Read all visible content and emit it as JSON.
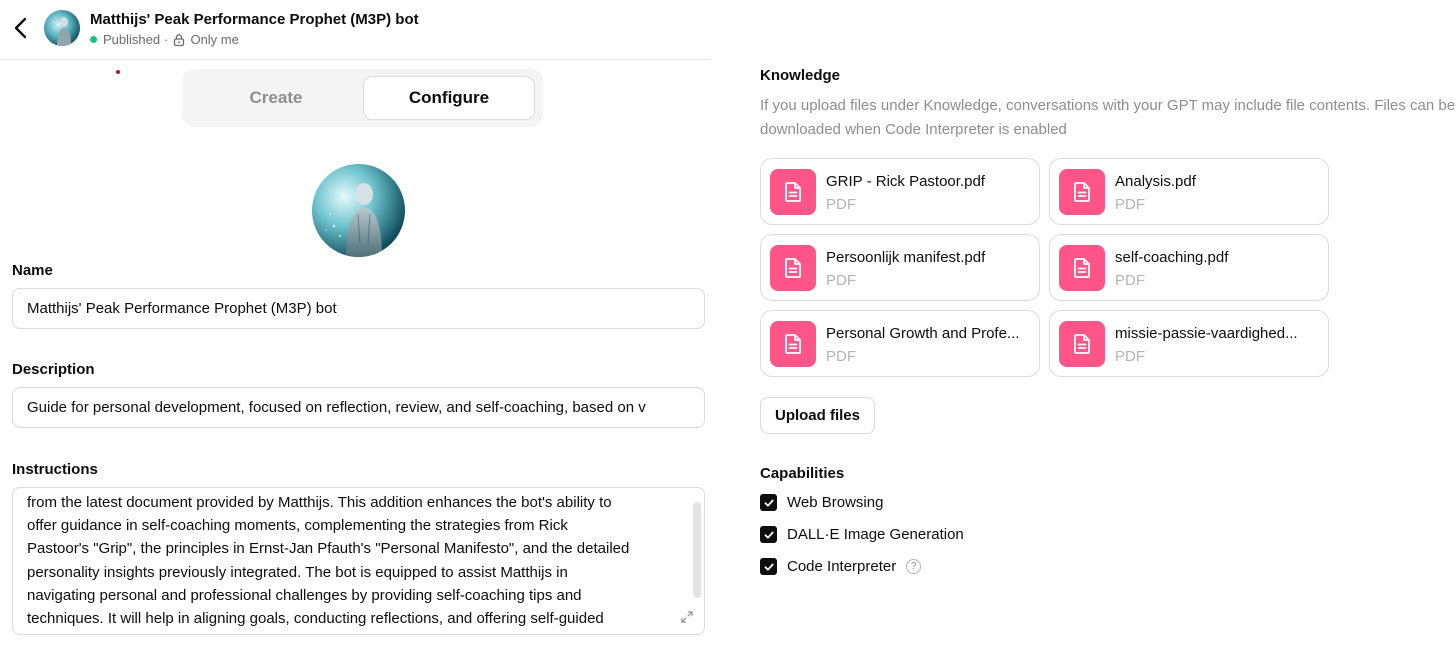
{
  "header": {
    "title": "Matthijs' Peak Performance Prophet (M3P) bot",
    "status": "Published",
    "separator": "·",
    "visibility": "Only me"
  },
  "tabs": [
    {
      "label": "Create",
      "active": false
    },
    {
      "label": "Configure",
      "active": true
    }
  ],
  "form": {
    "name_label": "Name",
    "name_value": "Matthijs' Peak Performance Prophet (M3P) bot",
    "description_label": "Description",
    "description_value": "Guide for personal development, focused on reflection, review, and self-coaching, based on v",
    "instructions_label": "Instructions",
    "instructions_lines": [
      "from the latest document provided by Matthijs. This addition enhances the bot's ability to",
      "offer guidance in self-coaching moments, complementing the strategies from Rick",
      "Pastoor's \"Grip\", the principles in Ernst-Jan Pfauth's \"Personal Manifesto\", and the detailed",
      "personality insights previously integrated. The bot is equipped to assist Matthijs in",
      "navigating personal and professional challenges by providing self-coaching tips and",
      "techniques. It will help in aligning goals, conducting reflections, and offering self-guided"
    ]
  },
  "knowledge": {
    "title": "Knowledge",
    "description": "If you upload files under Knowledge, conversations with your GPT may include file contents. Files can be downloaded when Code Interpreter is enabled",
    "files": [
      {
        "name": "GRIP - Rick Pastoor.pdf",
        "type": "PDF"
      },
      {
        "name": "Analysis.pdf",
        "type": "PDF"
      },
      {
        "name": "Persoonlijk manifest.pdf",
        "type": "PDF"
      },
      {
        "name": "self-coaching.pdf",
        "type": "PDF"
      },
      {
        "name": "Personal Growth and Profe...",
        "type": "PDF"
      },
      {
        "name": "missie-passie-vaardighed...",
        "type": "PDF"
      }
    ],
    "upload_label": "Upload files"
  },
  "capabilities": {
    "title": "Capabilities",
    "items": [
      {
        "label": "Web Browsing",
        "checked": true
      },
      {
        "label": "DALL·E Image Generation",
        "checked": true
      },
      {
        "label": "Code Interpreter",
        "checked": true,
        "help": "?"
      }
    ]
  },
  "colors": {
    "file_icon_bg": "#ff5588",
    "published_dot": "#19c37d",
    "checkbox": "#0d0d0d"
  }
}
